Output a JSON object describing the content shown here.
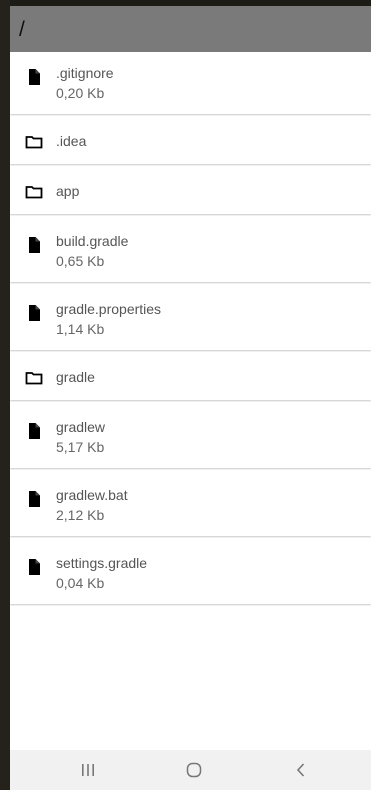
{
  "app_bar": {
    "path": "/"
  },
  "items": [
    {
      "type": "file",
      "icon": "file-icon",
      "name": ".gitignore",
      "size": "0,20 Kb"
    },
    {
      "type": "folder",
      "icon": "folder-icon",
      "name": ".idea",
      "size": ""
    },
    {
      "type": "folder",
      "icon": "folder-icon",
      "name": "app",
      "size": ""
    },
    {
      "type": "file",
      "icon": "file-icon",
      "name": "build.gradle",
      "size": "0,65 Kb"
    },
    {
      "type": "file",
      "icon": "file-icon",
      "name": "gradle.properties",
      "size": "1,14 Kb"
    },
    {
      "type": "folder",
      "icon": "folder-icon",
      "name": "gradle",
      "size": ""
    },
    {
      "type": "file",
      "icon": "file-icon",
      "name": "gradlew",
      "size": "5,17 Kb"
    },
    {
      "type": "file",
      "icon": "file-icon",
      "name": "gradlew.bat",
      "size": "2,12 Kb"
    },
    {
      "type": "file",
      "icon": "file-icon",
      "name": "settings.gradle",
      "size": "0,04 Kb"
    }
  ],
  "navbar": {
    "recents_icon": "recents-icon",
    "home_icon": "home-icon",
    "back_icon": "back-icon"
  },
  "colors": {
    "app_bar": "#7a7a7a",
    "icon": "#000000",
    "text": "#555555",
    "navbar": "#f1f1f1"
  }
}
